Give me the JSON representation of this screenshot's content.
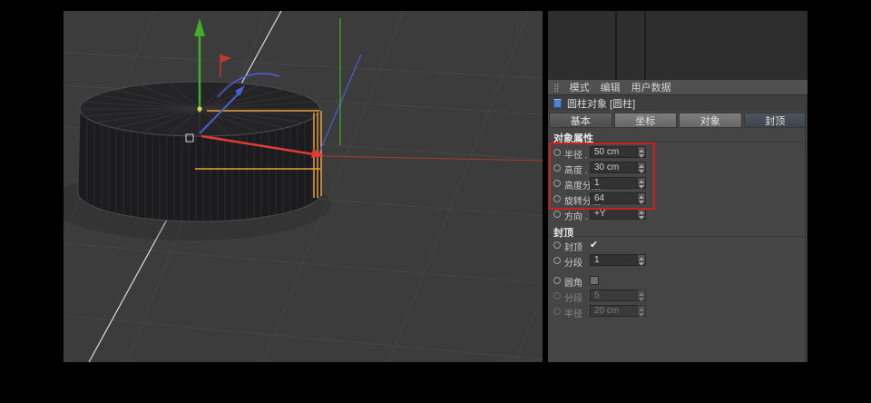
{
  "viewport": {
    "background": "#3c3c3c",
    "axis_colors": {
      "x": "#e03c31",
      "y": "#3fae29",
      "z": "#4a5fd0"
    },
    "highlight_color": "#e8a33d"
  },
  "icons": {
    "grip": "⣿",
    "check": "✔"
  },
  "panel": {
    "menu": {
      "items": [
        "模式",
        "编辑",
        "用户数据"
      ]
    },
    "object_header": {
      "title": "圆柱对象 [圆柱]"
    },
    "tabs": [
      {
        "label": "基本",
        "active": false
      },
      {
        "label": "坐标",
        "active": true
      },
      {
        "label": "对象",
        "active": true
      },
      {
        "label": "封顶",
        "active": false
      }
    ],
    "object_section": {
      "title": "对象属性",
      "rows": [
        {
          "label": "半径 . . .",
          "value": "50 cm"
        },
        {
          "label": "高度 . . .",
          "value": "30 cm"
        },
        {
          "label": "高度分段",
          "value": "1"
        },
        {
          "label": "旋转分段",
          "value": "64"
        },
        {
          "label": "方向 . . .",
          "value": "+Y"
        }
      ]
    },
    "caps_section": {
      "title": "封顶",
      "rows": [
        {
          "label": "封顶",
          "checked": true
        },
        {
          "label": "分段",
          "value": "1"
        },
        {
          "label": "圆角",
          "checked": false
        },
        {
          "label": "分段",
          "value": "5",
          "disabled": true
        },
        {
          "label": "半径",
          "value": "20 cm",
          "disabled": true
        }
      ]
    },
    "highlight_box_color": "#cf1f1f"
  }
}
